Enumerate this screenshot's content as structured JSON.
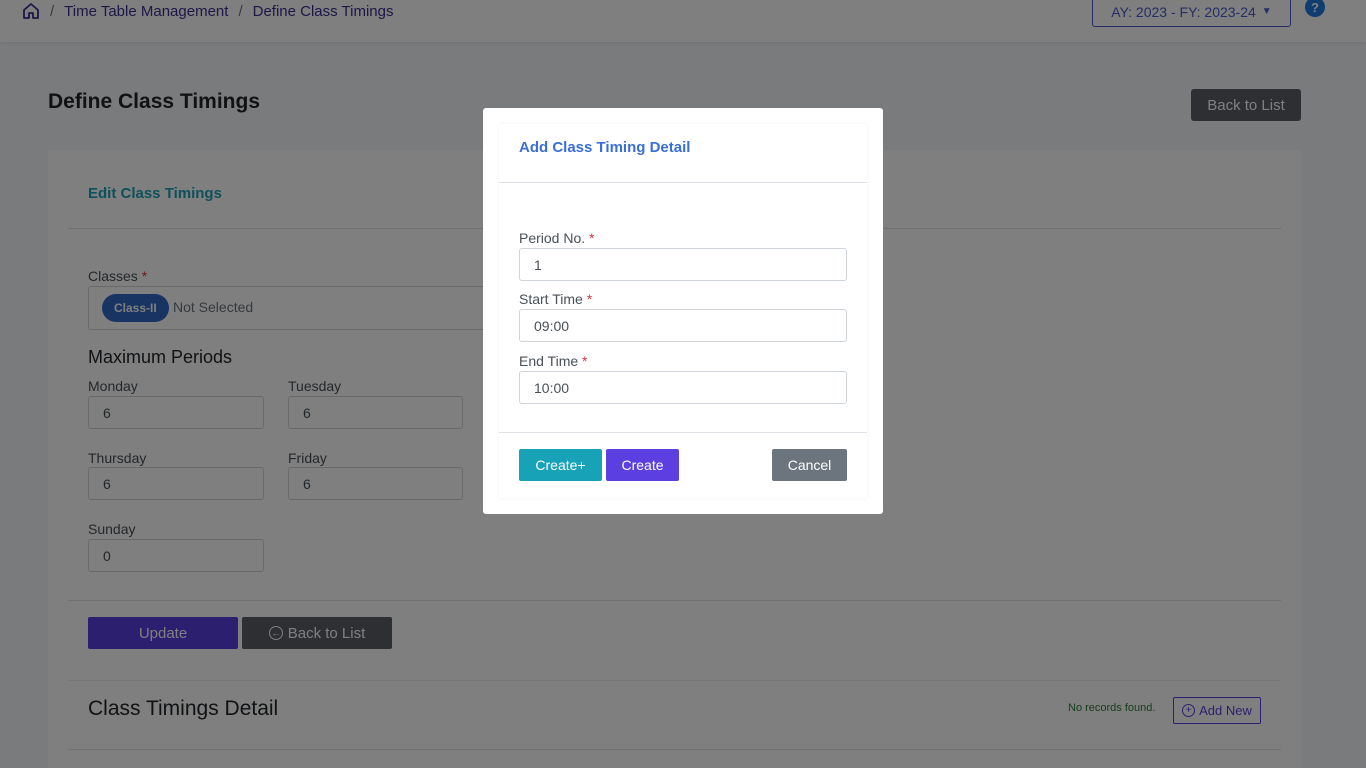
{
  "breadcrumb": {
    "items": [
      "Time Table Management",
      "Define Class Timings"
    ],
    "separator": "/"
  },
  "header": {
    "academic_year_label": "AY: 2023 - FY: 2023-24",
    "help_label": "?"
  },
  "page": {
    "title": "Define Class Timings",
    "back_to_list_label": "Back to List"
  },
  "edit_form": {
    "title": "Edit Class Timings",
    "classes_label": "Classes",
    "required_mark": "*",
    "selected_class_chip": "Class-II",
    "classes_placeholder": "Not Selected",
    "max_periods_heading": "Maximum Periods",
    "days": [
      {
        "label": "Monday",
        "value": "6"
      },
      {
        "label": "Tuesday",
        "value": "6"
      },
      {
        "label": "Thursday",
        "value": "6"
      },
      {
        "label": "Friday",
        "value": "6"
      },
      {
        "label": "Sunday",
        "value": "0"
      }
    ],
    "update_label": "Update",
    "back_to_list_label": "Back to List"
  },
  "detail": {
    "title": "Class Timings Detail",
    "no_records": "No records found.",
    "add_new_label": "Add New"
  },
  "modal": {
    "title": "Add Class Timing Detail",
    "period_label": "Period No.",
    "period_value": "1",
    "start_label": "Start Time",
    "start_value": "09:00",
    "end_label": "End Time",
    "end_value": "10:00",
    "required_mark": "*",
    "create_plus_label": "Create+",
    "create_label": "Create",
    "cancel_label": "Cancel"
  },
  "colors": {
    "primary": "#5b3fe0",
    "info": "#17a2b8",
    "secondary": "#6c757d",
    "chip": "#2f68c4"
  }
}
